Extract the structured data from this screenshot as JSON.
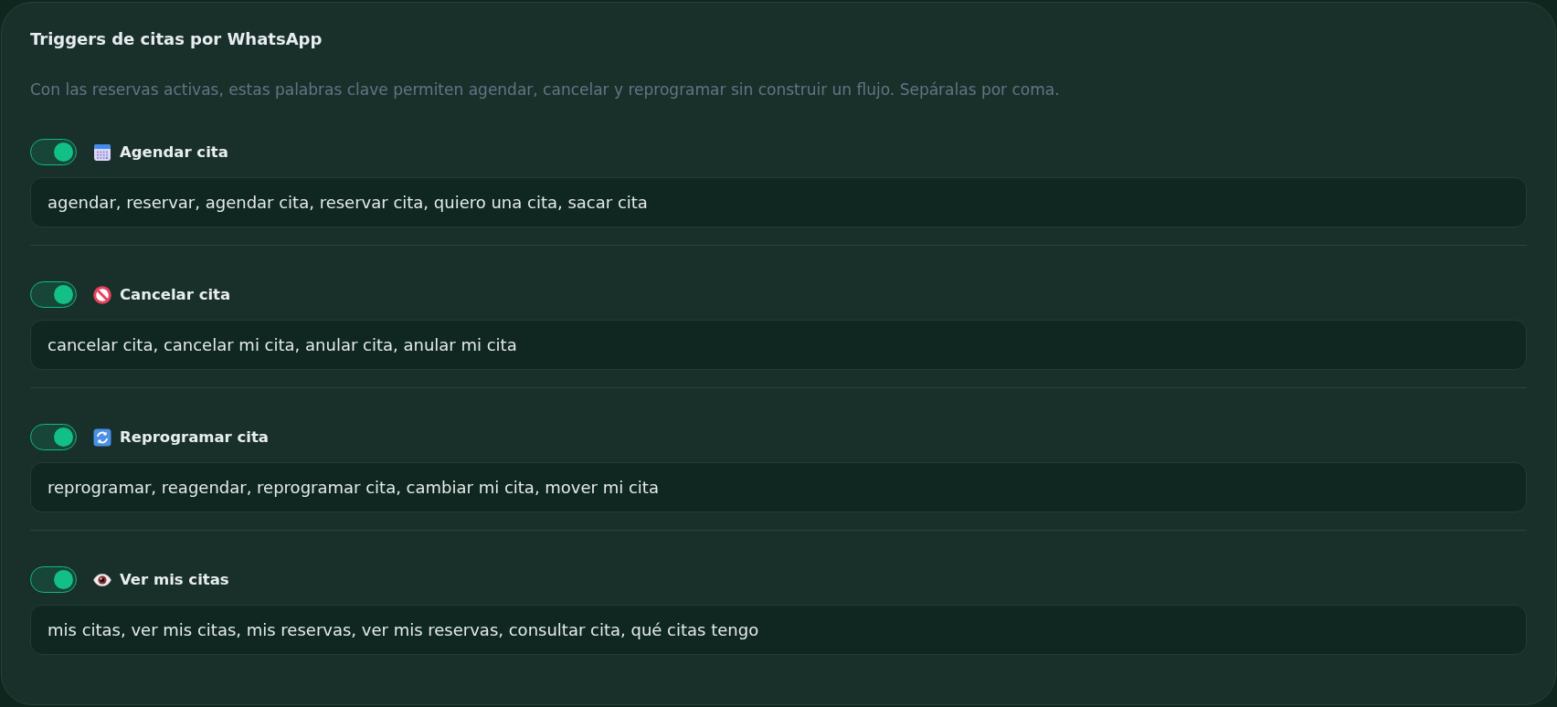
{
  "card": {
    "title": "Triggers de citas por WhatsApp",
    "description": "Con las reservas activas, estas palabras clave permiten agendar, cancelar y reprogramar sin construir un flujo. Sepáralas por coma."
  },
  "triggers": [
    {
      "kind": "book",
      "on": true,
      "label": "Agendar cita",
      "keywords": "agendar, reservar, agendar cita, reservar cita, quiero una cita, sacar cita"
    },
    {
      "kind": "cancel",
      "on": true,
      "label": "Cancelar cita",
      "keywords": "cancelar cita, cancelar mi cita, anular cita, anular mi cita"
    },
    {
      "kind": "reschedule",
      "on": true,
      "label": "Reprogramar cita",
      "keywords": "reprogramar, reagendar, reprogramar cita, cambiar mi cita, mover mi cita"
    },
    {
      "kind": "view",
      "on": true,
      "label": "Ver mis citas",
      "keywords": "mis citas, ver mis citas, mis reservas, ver mis reservas, consultar cita, qué citas tengo"
    }
  ]
}
